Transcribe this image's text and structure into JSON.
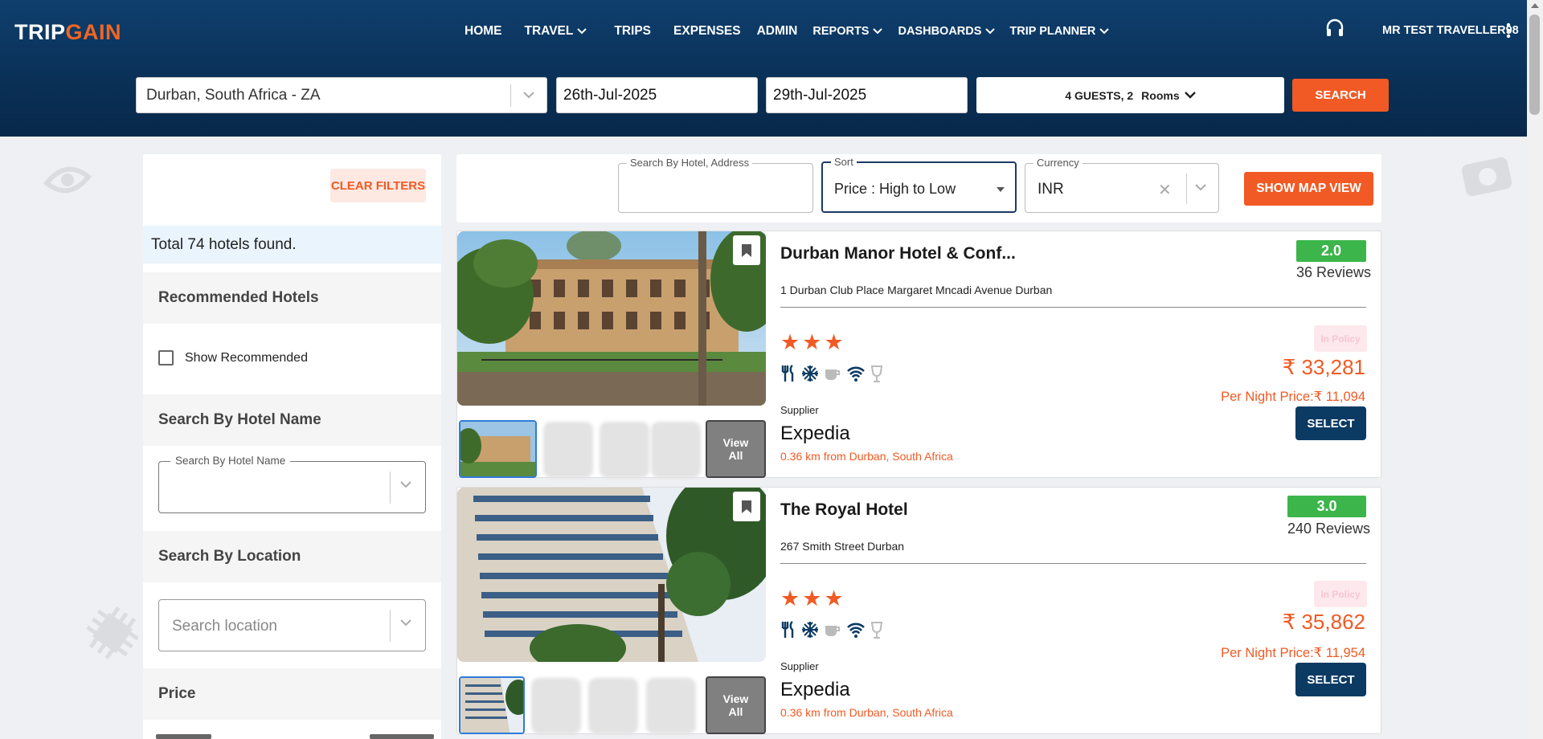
{
  "brand": {
    "part1": "TRIP",
    "part2": "GAIN"
  },
  "nav": {
    "items": [
      {
        "label": "HOME",
        "dropdown": false
      },
      {
        "label": "TRAVEL",
        "dropdown": true
      },
      {
        "label": "TRIPS",
        "dropdown": false
      },
      {
        "label": "EXPENSES",
        "dropdown": false
      },
      {
        "label": "ADMIN",
        "dropdown": false
      },
      {
        "label": "REPORTS",
        "dropdown": true
      },
      {
        "label": "DASHBOARDS",
        "dropdown": true
      },
      {
        "label": "TRIP PLANNER",
        "dropdown": true
      }
    ],
    "user": "MR TEST TRAVELLER98"
  },
  "search": {
    "destination": "Durban, South Africa - ZA",
    "checkin": "26th-Jul-2025",
    "checkout": "29th-Jul-2025",
    "guests": "4 GUESTS, 2",
    "rooms": "Rooms",
    "button": "SEARCH"
  },
  "sidebar": {
    "clear_filters": "CLEAR FILTERS",
    "total": "Total 74 hotels found.",
    "recommended_title": "Recommended Hotels",
    "show_recommended": "Show Recommended",
    "hotel_name_title": "Search By Hotel Name",
    "hotel_name_legend": "Search By Hotel Name",
    "location_title": "Search By Location",
    "location_placeholder": "Search location",
    "price_title": "Price"
  },
  "filters": {
    "search_legend": "Search By Hotel, Address",
    "sort_legend": "Sort",
    "sort_value": "Price : High to Low",
    "currency_legend": "Currency",
    "currency_value": "INR",
    "map_button": "SHOW MAP VIEW"
  },
  "hotels": [
    {
      "name": "Durban Manor Hotel & Conf...",
      "address": "1 Durban Club Place Margaret Mncadi Avenue Durban",
      "rating": "2.0",
      "reviews": "36 Reviews",
      "stars": 3,
      "policy": "In Policy",
      "price": "₹ 33,281",
      "per_night": "Per Night Price:₹ 11,094",
      "select": "SELECT",
      "supplier_label": "Supplier",
      "supplier": "Expedia",
      "distance": "0.36 km from Durban, South Africa",
      "view_all": "View All"
    },
    {
      "name": "The Royal Hotel",
      "address": "267 Smith Street Durban",
      "rating": "3.0",
      "reviews": "240 Reviews",
      "stars": 3,
      "policy": "In Policy",
      "price": "₹ 35,862",
      "per_night": "Per Night Price:₹ 11,954",
      "select": "SELECT",
      "supplier_label": "Supplier",
      "supplier": "Expedia",
      "distance": "0.36 km from Durban, South Africa",
      "view_all": "View All"
    }
  ],
  "colors": {
    "accent": "#f15a24",
    "header": "#0a3158",
    "select": "#0b3a63",
    "rating": "#3cb54a"
  }
}
